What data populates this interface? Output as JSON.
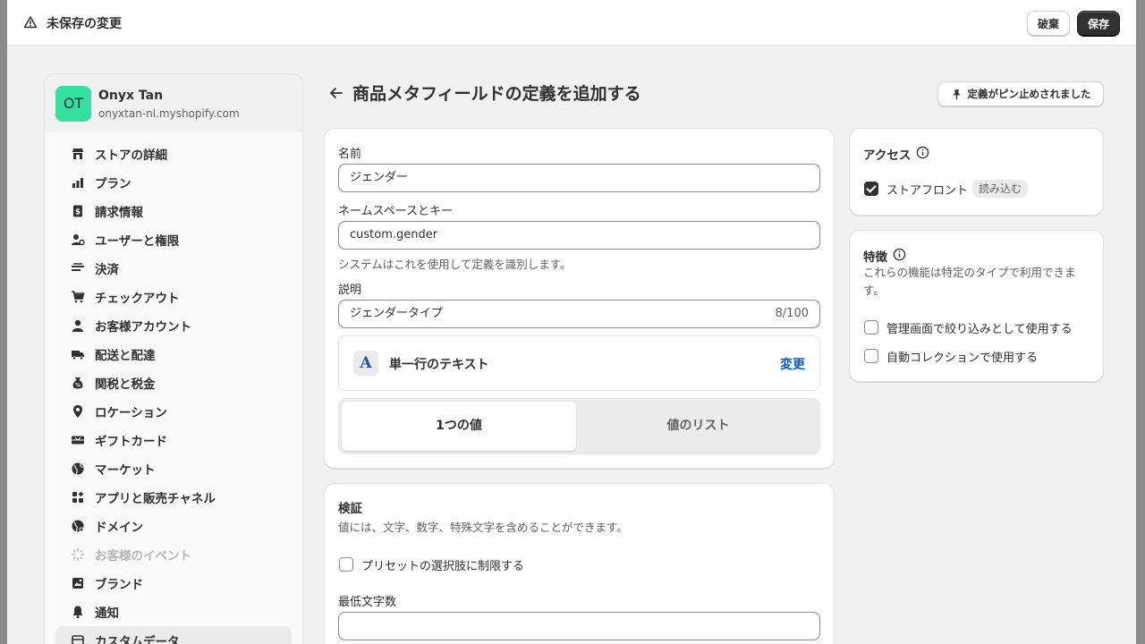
{
  "topbar": {
    "title": "未保存の変更",
    "discard_label": "破棄",
    "save_label": "保存"
  },
  "store": {
    "initials": "OT",
    "name": "Onyx Tan",
    "domain": "onyxtan-nl.myshopify.com"
  },
  "sidebar": {
    "items": [
      {
        "label": "ストアの詳細",
        "icon": "store-icon"
      },
      {
        "label": "プラン",
        "icon": "plan-icon"
      },
      {
        "label": "請求情報",
        "icon": "billing-icon"
      },
      {
        "label": "ユーザーと権限",
        "icon": "users-icon"
      },
      {
        "label": "決済",
        "icon": "payments-icon"
      },
      {
        "label": "チェックアウト",
        "icon": "cart-icon"
      },
      {
        "label": "お客様アカウント",
        "icon": "person-icon"
      },
      {
        "label": "配送と配達",
        "icon": "truck-icon"
      },
      {
        "label": "関税と税金",
        "icon": "tax-icon"
      },
      {
        "label": "ロケーション",
        "icon": "location-icon"
      },
      {
        "label": "ギフトカード",
        "icon": "gift-card-icon"
      },
      {
        "label": "マーケット",
        "icon": "globe-icon"
      },
      {
        "label": "アプリと販売チャネル",
        "icon": "apps-icon"
      },
      {
        "label": "ドメイン",
        "icon": "domain-globe-icon"
      },
      {
        "label": "お客様のイベント",
        "icon": "sparkle-icon"
      },
      {
        "label": "ブランド",
        "icon": "brand-icon"
      },
      {
        "label": "通知",
        "icon": "bell-icon"
      },
      {
        "label": "カスタムデータ",
        "icon": "custom-data-icon"
      }
    ]
  },
  "page": {
    "title": "商品メタフィールドの定義を追加する",
    "pinned_label": "定義がピン止めされました"
  },
  "form": {
    "name_label": "名前",
    "name_value": "ジェンダー",
    "key_label": "ネームスペースとキー",
    "key_value": "custom.gender",
    "key_hint": "システムはこれを使用して定義を識別します。",
    "desc_label": "説明",
    "desc_value": "ジェンダータイプ",
    "desc_counter": "8/100",
    "type_glyph": "A",
    "type_name": "単一行のテキスト",
    "type_change": "変更",
    "seg_one": "1つの値",
    "seg_list": "値のリスト"
  },
  "validation": {
    "title": "検証",
    "desc": "値には、文字、数字、特殊文字を含めることができます。",
    "preset_label": "プリセットの選択肢に制限する",
    "min_label": "最低文字数",
    "min_value": ""
  },
  "access": {
    "title": "アクセス",
    "storefront_label": "ストアフロント",
    "storefront_badge": "読み込む",
    "storefront_checked": true
  },
  "features": {
    "title": "特徴",
    "desc": "これらの機能は特定のタイプで利用できます。",
    "filter_label": "管理画面で絞り込みとして使用する",
    "collection_label": "自動コレクションで使用する"
  }
}
